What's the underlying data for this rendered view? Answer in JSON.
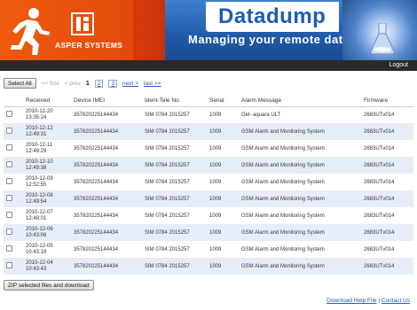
{
  "header": {
    "brand": "ASPER SYSTEMS",
    "title": "Datadump",
    "subtitle": "Managing your remote data"
  },
  "topbar": {
    "logout": "Logout"
  },
  "toolbar": {
    "select_all": "Select All",
    "first": "<< first",
    "prev": "< prev",
    "pages": [
      "1",
      "2",
      "3"
    ],
    "next": "next >",
    "last": "last >>"
  },
  "table": {
    "columns": [
      "Received",
      "Device IMEI",
      "Ident-Tele No.",
      "Serial",
      "Alarm Message",
      "Firmware"
    ],
    "rows": [
      {
        "date": "2010-12-20",
        "time": "13:35:24",
        "imei": "357820225144434",
        "ident": "SIM 0784 2015257",
        "serial": "1009",
        "alarm": "Gel- aquara ULT",
        "firmware": "2683UTv014"
      },
      {
        "date": "2010-12-12",
        "time": "12:49:31",
        "imei": "357820225144434",
        "ident": "SIM 0784 2015257",
        "serial": "1009",
        "alarm": "GSM Alarm and Monitoring System",
        "firmware": "2683UTv014"
      },
      {
        "date": "2010-12-11",
        "time": "12:49:29",
        "imei": "357820225144434",
        "ident": "SIM 0784 2015257",
        "serial": "1009",
        "alarm": "GSM Alarm and Monitoring System",
        "firmware": "2683UTv014"
      },
      {
        "date": "2010-12-10",
        "time": "12:49:38",
        "imei": "357820225144434",
        "ident": "SIM 0784 2015257",
        "serial": "1009",
        "alarm": "GSM Alarm and Monitoring System",
        "firmware": "2683UTv014"
      },
      {
        "date": "2010-12-09",
        "time": "12:52:55",
        "imei": "357820225144434",
        "ident": "SIM 0784 2015257",
        "serial": "1009",
        "alarm": "GSM Alarm and Monitoring System",
        "firmware": "2683UTv014"
      },
      {
        "date": "2010-12-08",
        "time": "12:49:54",
        "imei": "357820225144434",
        "ident": "SIM 0784 2015257",
        "serial": "1009",
        "alarm": "GSM Alarm and Monitoring System",
        "firmware": "2683UTv014"
      },
      {
        "date": "2010-12-07",
        "time": "12:48:01",
        "imei": "357820225144434",
        "ident": "SIM 0784 2015257",
        "serial": "1009",
        "alarm": "GSM Alarm and Monitoring System",
        "firmware": "2683UTv014"
      },
      {
        "date": "2010-12-06",
        "time": "10:43:06",
        "imei": "357820225144434",
        "ident": "SIM 0784 2015257",
        "serial": "1009",
        "alarm": "GSM Alarm and Monitoring System",
        "firmware": "2683UTv014"
      },
      {
        "date": "2010-12-05",
        "time": "10:43:18",
        "imei": "357820225144434",
        "ident": "SIM 0784 2015257",
        "serial": "1009",
        "alarm": "GSM Alarm and Monitoring System",
        "firmware": "2683UTv014"
      },
      {
        "date": "2010-12-04",
        "time": "10:43:43",
        "imei": "357820225144434",
        "ident": "SIM 0784 2015257",
        "serial": "1009",
        "alarm": "GSM Alarm and Monitoring System",
        "firmware": "2683UTv014"
      }
    ]
  },
  "actions": {
    "zip_download": "ZIP selected files and download"
  },
  "footer": {
    "help": "Download Help File",
    "separator": "|",
    "contact": "Contact Us"
  },
  "colors": {
    "brand_orange": "#e9450a",
    "brand_blue": "#1d5db3",
    "row_alt": "#e6edf8",
    "link": "#2859b8"
  }
}
